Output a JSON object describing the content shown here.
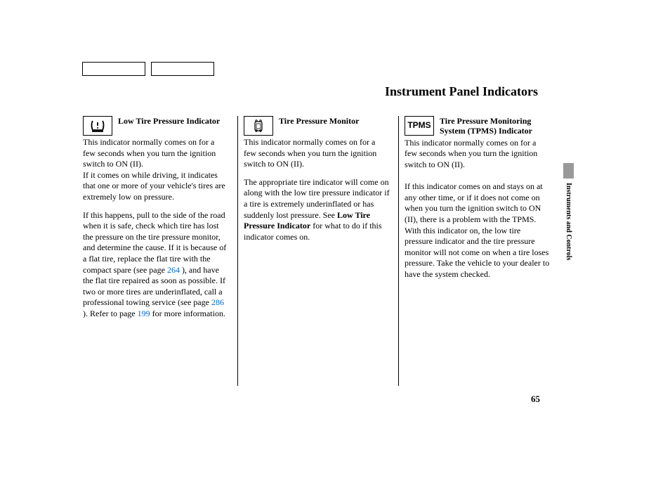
{
  "page_title": "Instrument Panel Indicators",
  "side_tab": "Instruments and Controls",
  "page_number": "65",
  "columns": {
    "col1": {
      "title": "Low Tire Pressure Indicator",
      "p1": "This indicator normally comes on for a few seconds when you turn the ignition switch to ON (II).",
      "p2": "If it comes on while driving, it indicates that one or more of your vehicle's tires are extremely low on pressure.",
      "p3a": "If this happens, pull to the side of the road when it is safe, check which tire has lost the pressure on the tire pressure monitor, and determine the cause. If it is because of a flat tire, replace the flat tire with the compact spare (see page ",
      "p3_ref1": "264",
      "p3b": " ), and have the flat tire repaired as soon as possible. If two or more tires are underinflated, call a professional towing service (see page ",
      "p3_ref2": "286",
      "p3c": " ). Refer to page ",
      "p3_ref3": "199",
      "p3d": " for more information."
    },
    "col2": {
      "title": "Tire Pressure Monitor",
      "p1": "This indicator normally comes on for a few seconds when you turn the ignition switch to ON (II).",
      "p2a": "The appropriate tire indicator will come on along with the low tire pressure indicator if a tire is extremely underinflated or has suddenly lost pressure. See ",
      "p2_bold": "Low Tire Pressure Indicator",
      "p2b": " for what to do if this indicator comes on."
    },
    "col3": {
      "icon_text": "TPMS",
      "title": "Tire Pressure Monitoring System (TPMS) Indicator",
      "p1": "This indicator normally comes on for a few seconds when you turn the ignition switch to ON (II).",
      "p2": "If this indicator comes on and stays on at any other time, or if it does not come on when you turn the ignition switch to ON (II), there is a problem with the TPMS. With this indicator on, the low tire pressure indicator and the tire pressure monitor will not come on when a tire loses pressure. Take the vehicle to your dealer to have the system checked."
    }
  }
}
